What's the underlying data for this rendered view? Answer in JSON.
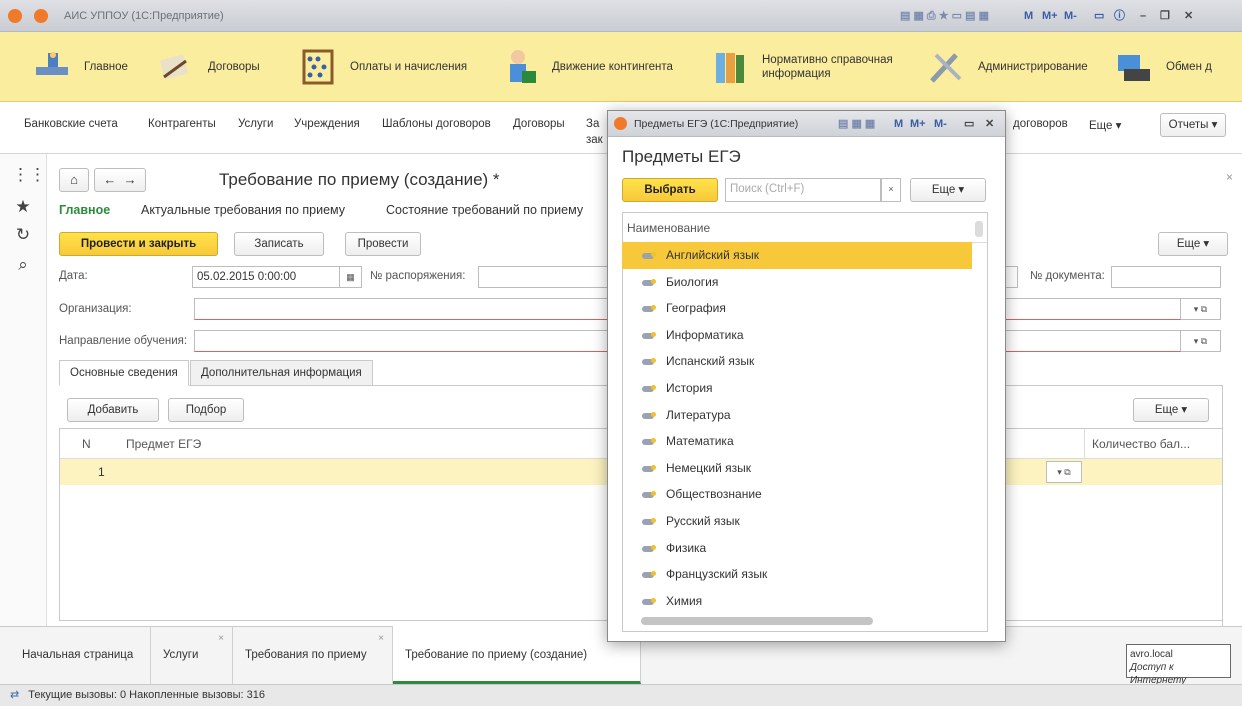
{
  "app": {
    "title": "АИС УППОУ  (1С:Предприятие)"
  },
  "toolbar_quick": {
    "m": "M",
    "mplus": "M+",
    "mminus": "M-"
  },
  "sections": [
    {
      "label": "Главное",
      "icon": "home-desk-icon"
    },
    {
      "label": "Договоры",
      "icon": "handshake-icon"
    },
    {
      "label": "Оплаты и начисления",
      "icon": "abacus-icon"
    },
    {
      "label": "Движение контингента",
      "icon": "people-icon"
    },
    {
      "label": "Нормативно справочная информация",
      "icon": "books-icon"
    },
    {
      "label": "Администрирование",
      "icon": "tools-icon"
    },
    {
      "label": "Обмен д",
      "icon": "exchange-icon"
    }
  ],
  "commands": [
    "Банковские счета",
    "Контрагенты",
    "Услуги",
    "Учреждения",
    "Шаблоны договоров",
    "Договоры",
    "За",
    "зак",
    "договоров",
    "Еще",
    "Отчеты"
  ],
  "form": {
    "title": "Требование по приему (создание) *",
    "nav_tabs": [
      "Главное",
      "Актуальные требования по приему",
      "Состояние требований по приему"
    ],
    "buttons": {
      "post_close": "Провести и закрыть",
      "save": "Записать",
      "post": "Провести",
      "more": "Еще"
    },
    "date_label": "Дата:",
    "date_value": "05.02.2015  0:00:00",
    "order_label": "№ распоряжения:",
    "doc_label": "№ документа:",
    "org_label": "Организация:",
    "direction_label": "Направление обучения:",
    "tabs": [
      "Основные сведения",
      "Дополнительная информация"
    ],
    "grid_buttons": {
      "add": "Добавить",
      "pick": "Подбор",
      "more": "Еще"
    },
    "grid_headers": {
      "n": "N",
      "subject": "Предмет ЕГЭ",
      "points": "Количество бал..."
    },
    "row_number": "1"
  },
  "bottom_tabs": [
    {
      "label": "Начальная страница"
    },
    {
      "label": "Услуги"
    },
    {
      "label": "Требования по приему"
    },
    {
      "label": "Требование по приему (создание)"
    }
  ],
  "status": {
    "text": "Текущие вызовы: 0  Накопленные вызовы: 316"
  },
  "network": {
    "host": "avro.local",
    "access": "Доступ к Интернету"
  },
  "dialog": {
    "window_title": "Предметы ЕГЭ  (1С:Предприятие)",
    "heading": "Предметы ЕГЭ",
    "select_button": "Выбрать",
    "search_placeholder": "Поиск (Ctrl+F)",
    "more": "Еще",
    "column": "Наименование",
    "items": [
      "Английский язык",
      "Биология",
      "География",
      "Информатика",
      "Испанский язык",
      "История",
      "Литература",
      "Математика",
      "Немецкий язык",
      "Обществознание",
      "Русский язык",
      "Физика",
      "Французский язык",
      "Химия"
    ],
    "selected_index": 0
  },
  "colors": {
    "accent_yellow": "#f7c93a",
    "section_bg": "#fbed9e",
    "selected_row": "#fdf3c1",
    "nav_green": "#2e8b3e"
  }
}
